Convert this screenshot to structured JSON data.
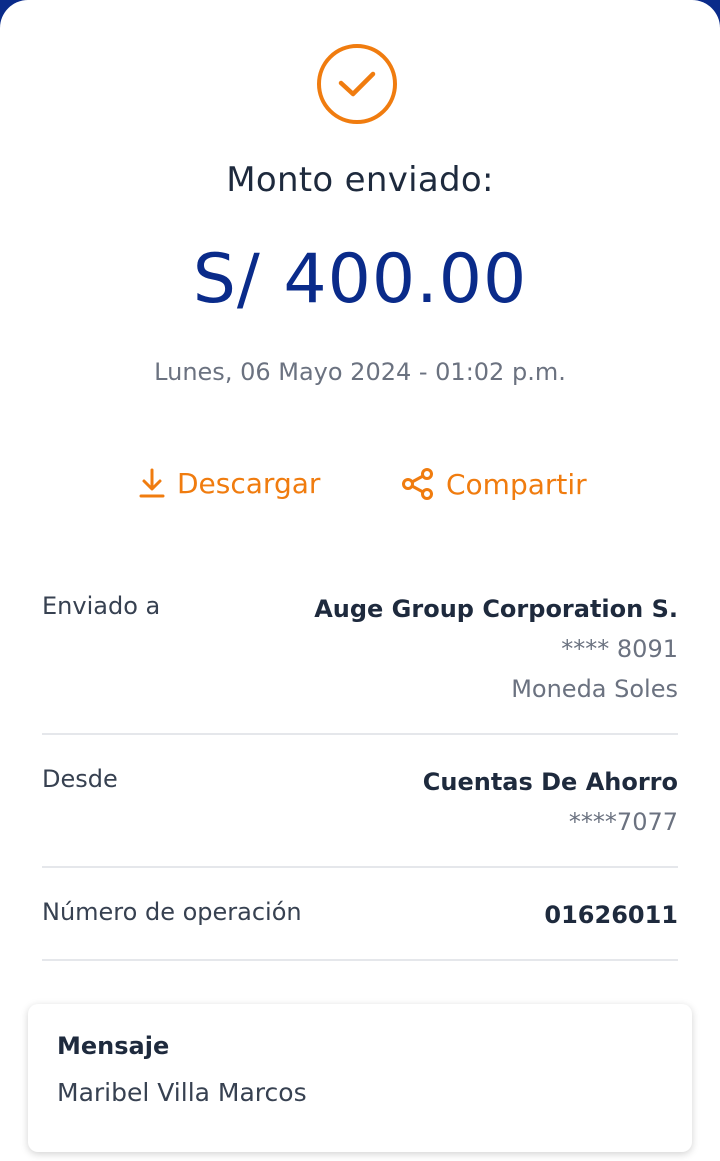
{
  "receipt": {
    "title": "Monto enviado:",
    "amount": "S/ 400.00",
    "date": "Lunes, 06 Mayo 2024 - 01:02 p.m."
  },
  "actions": {
    "download_label": "Descargar",
    "download_icon": "download-icon",
    "share_label": "Compartir",
    "share_icon": "share-icon"
  },
  "details": {
    "sent_to": {
      "label": "Enviado a",
      "name": "Auge Group Corporation S.",
      "account": "**** 8091",
      "currency": "Moneda Soles"
    },
    "from": {
      "label": "Desde",
      "account_type": "Cuentas De Ahorro",
      "account": "****7077"
    },
    "operation": {
      "label": "Número de operación",
      "number": "01626011"
    }
  },
  "message": {
    "label": "Mensaje",
    "text": "Maribel Villa Marcos"
  },
  "colors": {
    "accent": "#f07c0f",
    "brand": "#0a2b8a",
    "text_dark": "#1e2a3d",
    "text_muted": "#6b7280"
  }
}
